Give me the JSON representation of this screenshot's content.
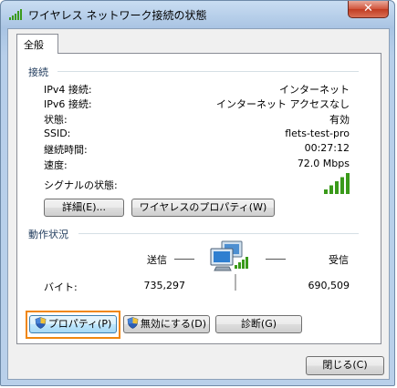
{
  "window": {
    "title": "ワイヤレス ネットワーク接続の状態",
    "close_glyph": "✕"
  },
  "tab": {
    "label": "全般"
  },
  "connection": {
    "section_title": "接続",
    "rows": [
      {
        "label": "IPv4 接続:",
        "value": "インターネット"
      },
      {
        "label": "IPv6 接続:",
        "value": "インターネット アクセスなし"
      },
      {
        "label": "状態:",
        "value": "有効"
      },
      {
        "label": "SSID:",
        "value": "flets-test-pro"
      },
      {
        "label": "継続時間:",
        "value": "00:27:12"
      },
      {
        "label": "速度:",
        "value": "72.0 Mbps"
      }
    ],
    "signal_label": "シグナルの状態:",
    "signal_bars": 5,
    "details_button": "詳細(E)...",
    "wireless_props_button": "ワイヤレスのプロパティ(W)"
  },
  "activity": {
    "section_title": "動作状況",
    "sent_label": "送信",
    "received_label": "受信",
    "bytes_label": "バイト:",
    "bytes_sent": "735,297",
    "bytes_received": "690,509"
  },
  "buttons": {
    "properties": "プロパティ(P)",
    "disable": "無効にする(D)",
    "diagnose": "診断(G)",
    "close": "閉じる(C)"
  },
  "colors": {
    "signal": "#3a9a1a",
    "highlight": "#f0860f",
    "section_title": "#1e395b"
  }
}
